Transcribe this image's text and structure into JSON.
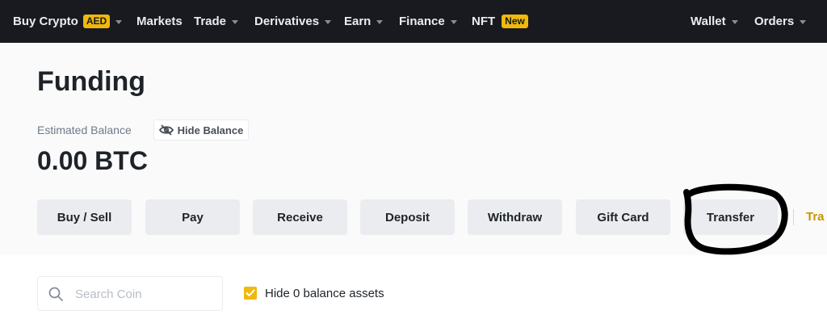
{
  "nav": {
    "items": [
      {
        "label": "Buy Crypto",
        "badge": "AED",
        "has_caret": true
      },
      {
        "label": "Markets",
        "has_caret": false
      },
      {
        "label": "Trade",
        "has_caret": true
      },
      {
        "label": "Derivatives",
        "has_caret": true
      },
      {
        "label": "Earn",
        "has_caret": true
      },
      {
        "label": "Finance",
        "has_caret": true
      },
      {
        "label": "NFT",
        "badge": "New",
        "has_caret": false
      }
    ],
    "right_items": [
      {
        "label": "Wallet",
        "has_caret": true
      },
      {
        "label": "Orders",
        "has_caret": true
      }
    ]
  },
  "page": {
    "title": "Funding",
    "estimated_balance_label": "Estimated Balance",
    "hide_balance_label": "Hide Balance",
    "balance_value": "0.00 BTC"
  },
  "actions": [
    {
      "label": "Buy / Sell"
    },
    {
      "label": "Pay"
    },
    {
      "label": "Receive"
    },
    {
      "label": "Deposit"
    },
    {
      "label": "Withdraw"
    },
    {
      "label": "Gift Card"
    },
    {
      "label": "Transfer"
    }
  ],
  "truncated_link": "Tra",
  "filters": {
    "search_placeholder": "Search Coin",
    "hide_zero_label": "Hide 0 balance assets",
    "hide_zero_checked": true
  },
  "colors": {
    "nav_bg": "#181a20",
    "accent": "#f0b90b",
    "button_bg": "#eaecef",
    "link": "#c99400"
  }
}
